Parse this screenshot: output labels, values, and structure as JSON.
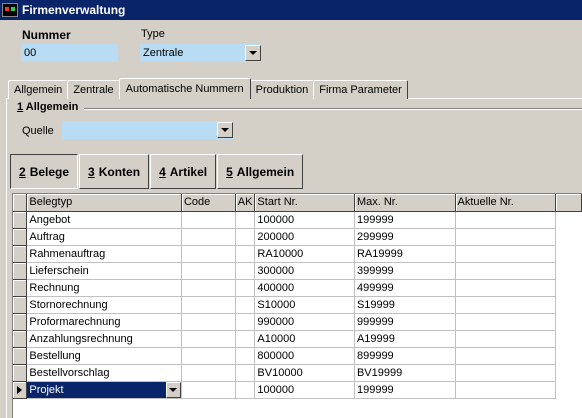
{
  "window": {
    "title": "Firmenverwaltung"
  },
  "header": {
    "nummer_label": "Nummer",
    "nummer_value": "00",
    "type_label": "Type",
    "type_value": "Zentrale"
  },
  "tabs": [
    {
      "label": "Allgemein",
      "active": false
    },
    {
      "label": "Zentrale",
      "active": false
    },
    {
      "label": "Automatische Nummern",
      "active": true
    },
    {
      "label": "Produktion",
      "active": false
    },
    {
      "label": "Firma Parameter",
      "active": false
    }
  ],
  "group": {
    "number": "1",
    "title": "Allgemein",
    "quelle_label": "Quelle",
    "quelle_value": ""
  },
  "subtabs": [
    {
      "number": "2",
      "label": "Belege",
      "active": true
    },
    {
      "number": "3",
      "label": "Konten",
      "active": false
    },
    {
      "number": "4",
      "label": "Artikel",
      "active": false
    },
    {
      "number": "5",
      "label": "Allgemein",
      "active": false
    }
  ],
  "grid": {
    "columns": [
      "Belegtyp",
      "Code",
      "AK",
      "Start Nr.",
      "Max. Nr.",
      "Aktuelle Nr."
    ],
    "rows": [
      [
        "Angebot",
        "",
        "",
        "100000",
        "199999",
        ""
      ],
      [
        "Auftrag",
        "",
        "",
        "200000",
        "299999",
        ""
      ],
      [
        "Rahmenauftrag",
        "",
        "",
        "RA10000",
        "RA19999",
        ""
      ],
      [
        "Lieferschein",
        "",
        "",
        "300000",
        "399999",
        ""
      ],
      [
        "Rechnung",
        "",
        "",
        "400000",
        "499999",
        ""
      ],
      [
        "Stornorechnung",
        "",
        "",
        "S10000",
        "S19999",
        ""
      ],
      [
        "Proformarechnung",
        "",
        "",
        "990000",
        "999999",
        ""
      ],
      [
        "Anzahlungsrechnung",
        "",
        "",
        "A10000",
        "A19999",
        ""
      ],
      [
        "Bestellung",
        "",
        "",
        "800000",
        "899999",
        ""
      ],
      [
        "Bestellvorschlag",
        "",
        "",
        "BV10000",
        "BV19999",
        ""
      ],
      [
        "Projekt",
        "",
        "",
        "100000",
        "199999",
        ""
      ]
    ],
    "current_row": 10
  },
  "colors": {
    "field_bg": "#b9dcf5",
    "title_bar": "#0a246a",
    "selection": "#0a246a",
    "dialog_bg": "#d4d0c8"
  }
}
